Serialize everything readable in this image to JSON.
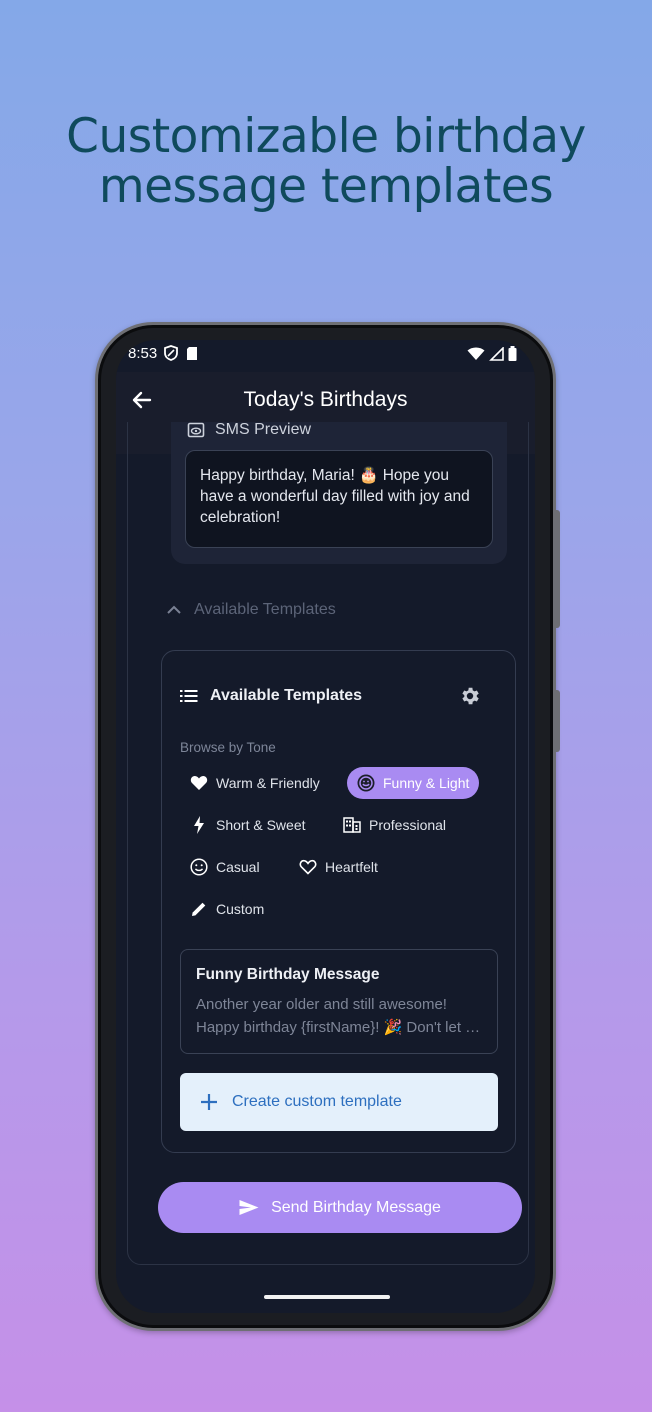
{
  "headline": {
    "line1": "Customizable birthday",
    "line2": "message templates"
  },
  "status": {
    "time": "8:53"
  },
  "appbar": {
    "title": "Today's Birthdays"
  },
  "sms_preview": {
    "header": "SMS Preview",
    "text": "Happy birthday, Maria! 🎂 Hope you have a wonderful day filled with joy and celebration!"
  },
  "collapse": {
    "label": "Available Templates"
  },
  "templates": {
    "title": "Available Templates",
    "browse_label": "Browse by Tone",
    "tones": [
      {
        "label": "Warm & Friendly",
        "icon": "heart-filled-icon",
        "selected": false
      },
      {
        "label": "Funny & Light",
        "icon": "emoji-icon",
        "selected": true
      },
      {
        "label": "Short & Sweet",
        "icon": "bolt-icon",
        "selected": false
      },
      {
        "label": "Professional",
        "icon": "building-icon",
        "selected": false
      },
      {
        "label": "Casual",
        "icon": "smiley-icon",
        "selected": false
      },
      {
        "label": "Heartfelt",
        "icon": "heart-outline-icon",
        "selected": false
      },
      {
        "label": "Custom",
        "icon": "pencil-icon",
        "selected": false
      }
    ],
    "message": {
      "title": "Funny Birthday Message",
      "line1": "Another year older and still awesome!",
      "line2": "Happy birthday {firstName}! 🎉 Don't let anyone tell you otherwise"
    },
    "create_label": "Create custom template"
  },
  "send_label": "Send Birthday Message",
  "colors": {
    "accent": "#a98bf2",
    "headline": "#0f4a5c",
    "create_text": "#2d6fbf"
  }
}
